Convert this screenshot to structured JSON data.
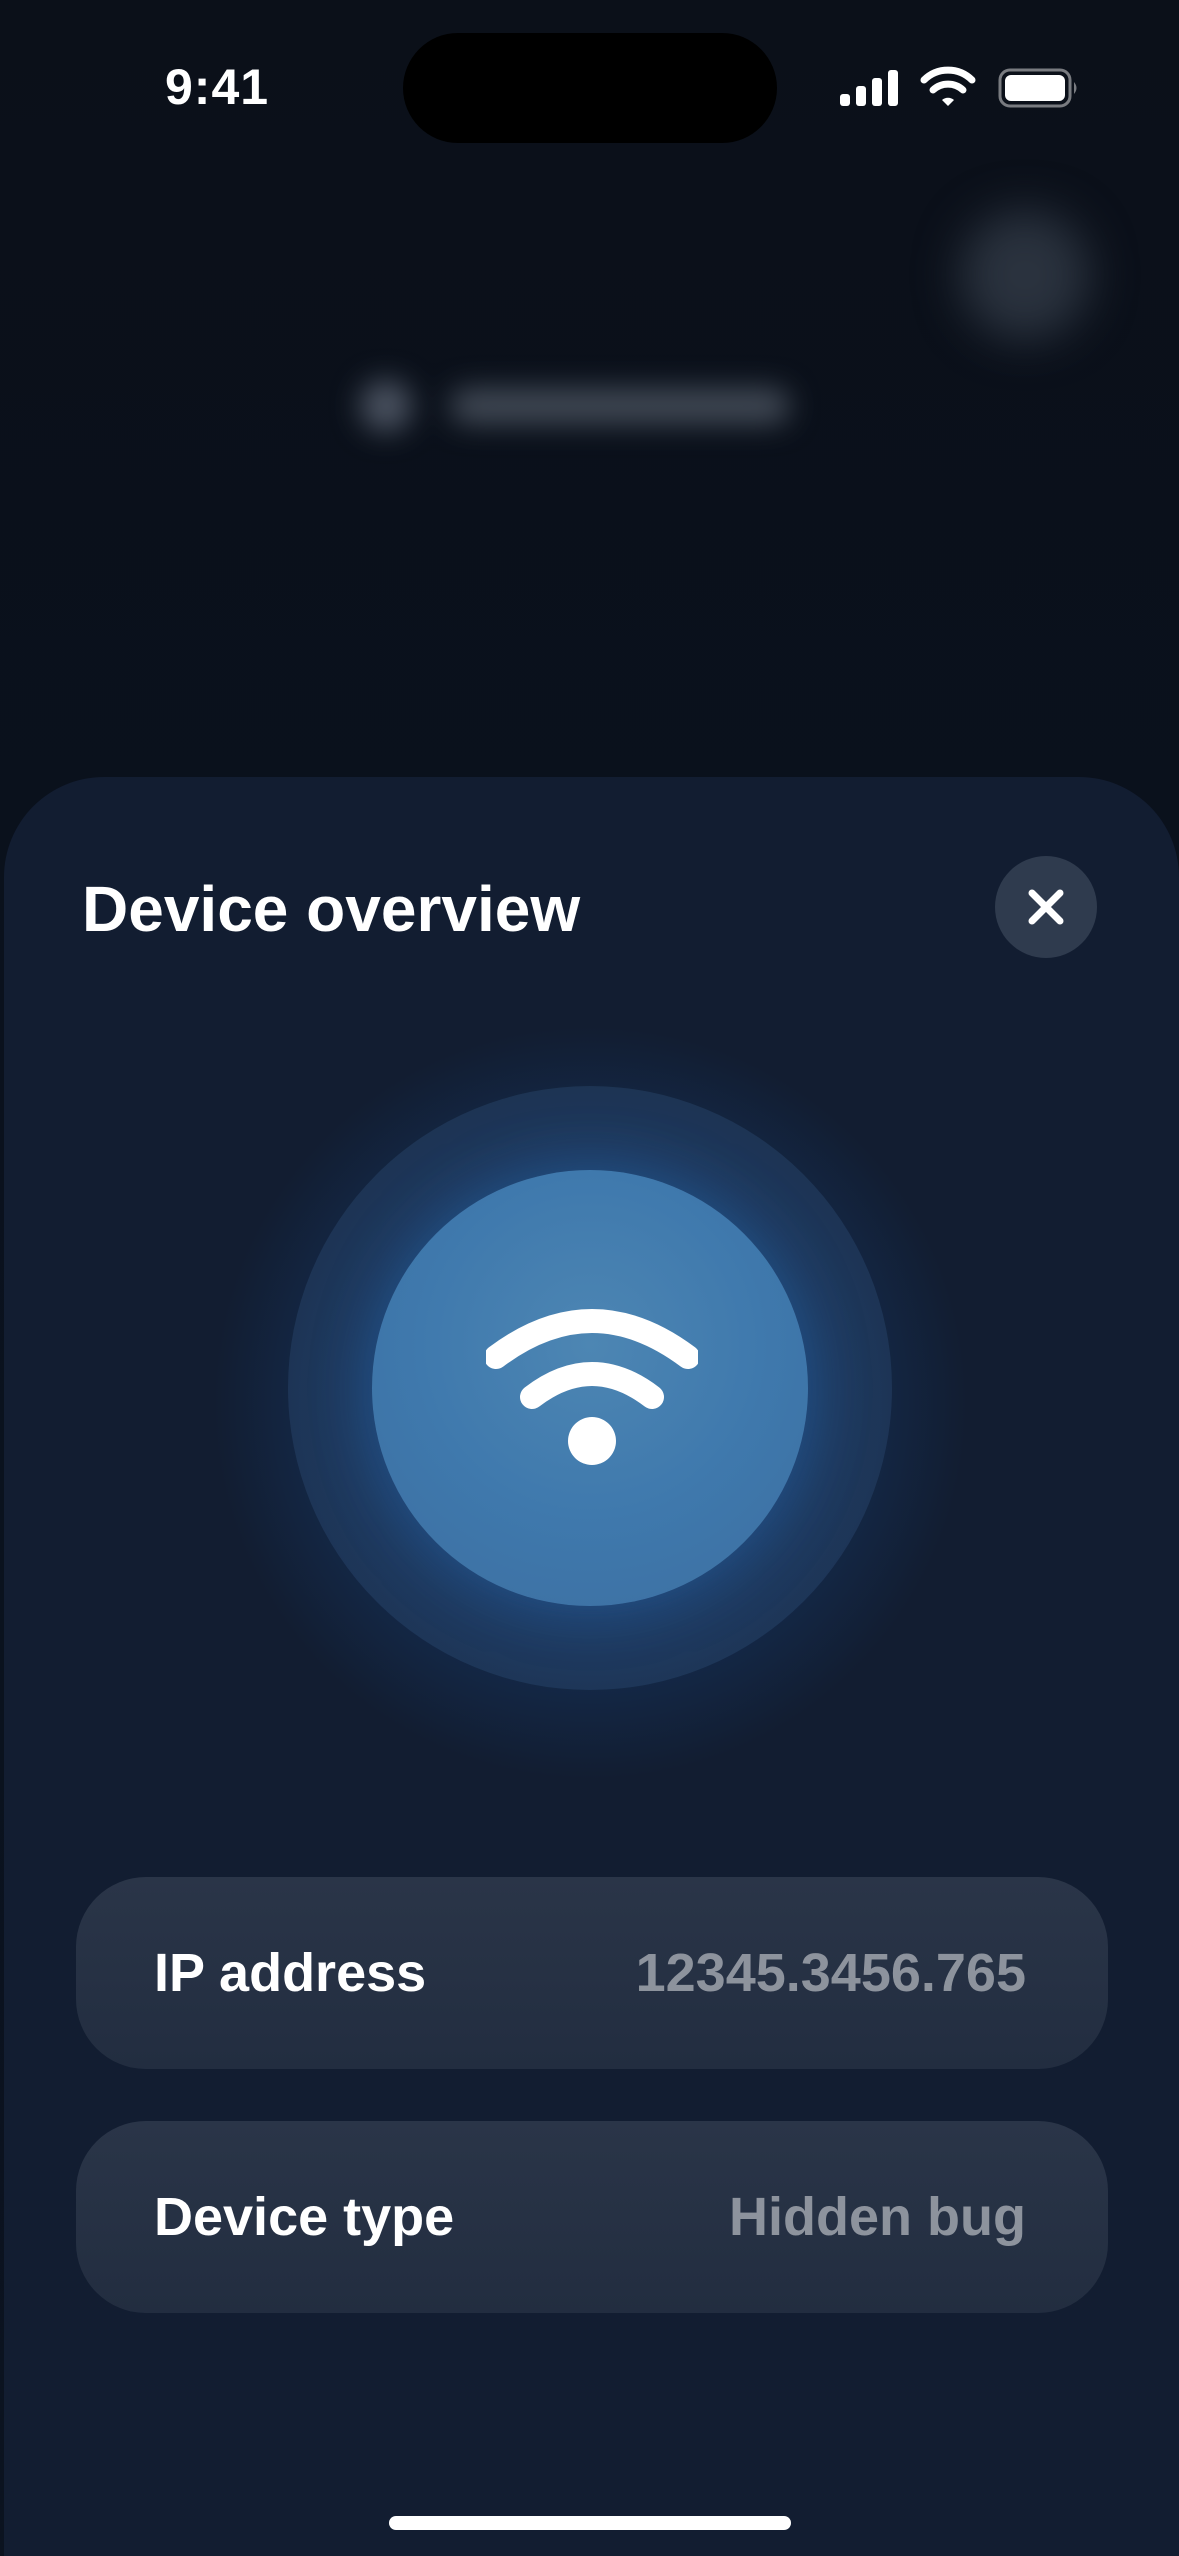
{
  "status_bar": {
    "time": "9:41",
    "icons": [
      "cellular-signal-icon",
      "wifi-icon",
      "battery-icon"
    ]
  },
  "sheet": {
    "title": "Device overview",
    "close_icon": "close-icon",
    "hero_icon": "wifi-icon",
    "info": [
      {
        "label": "IP address",
        "value": "12345.3456.765"
      },
      {
        "label": "Device type",
        "value": "Hidden bug"
      }
    ]
  },
  "colors": {
    "background": "#0a111d",
    "sheet": "#121d31",
    "card": "#263246",
    "accent": "#3f79ad",
    "value_text": "#8d939d"
  }
}
